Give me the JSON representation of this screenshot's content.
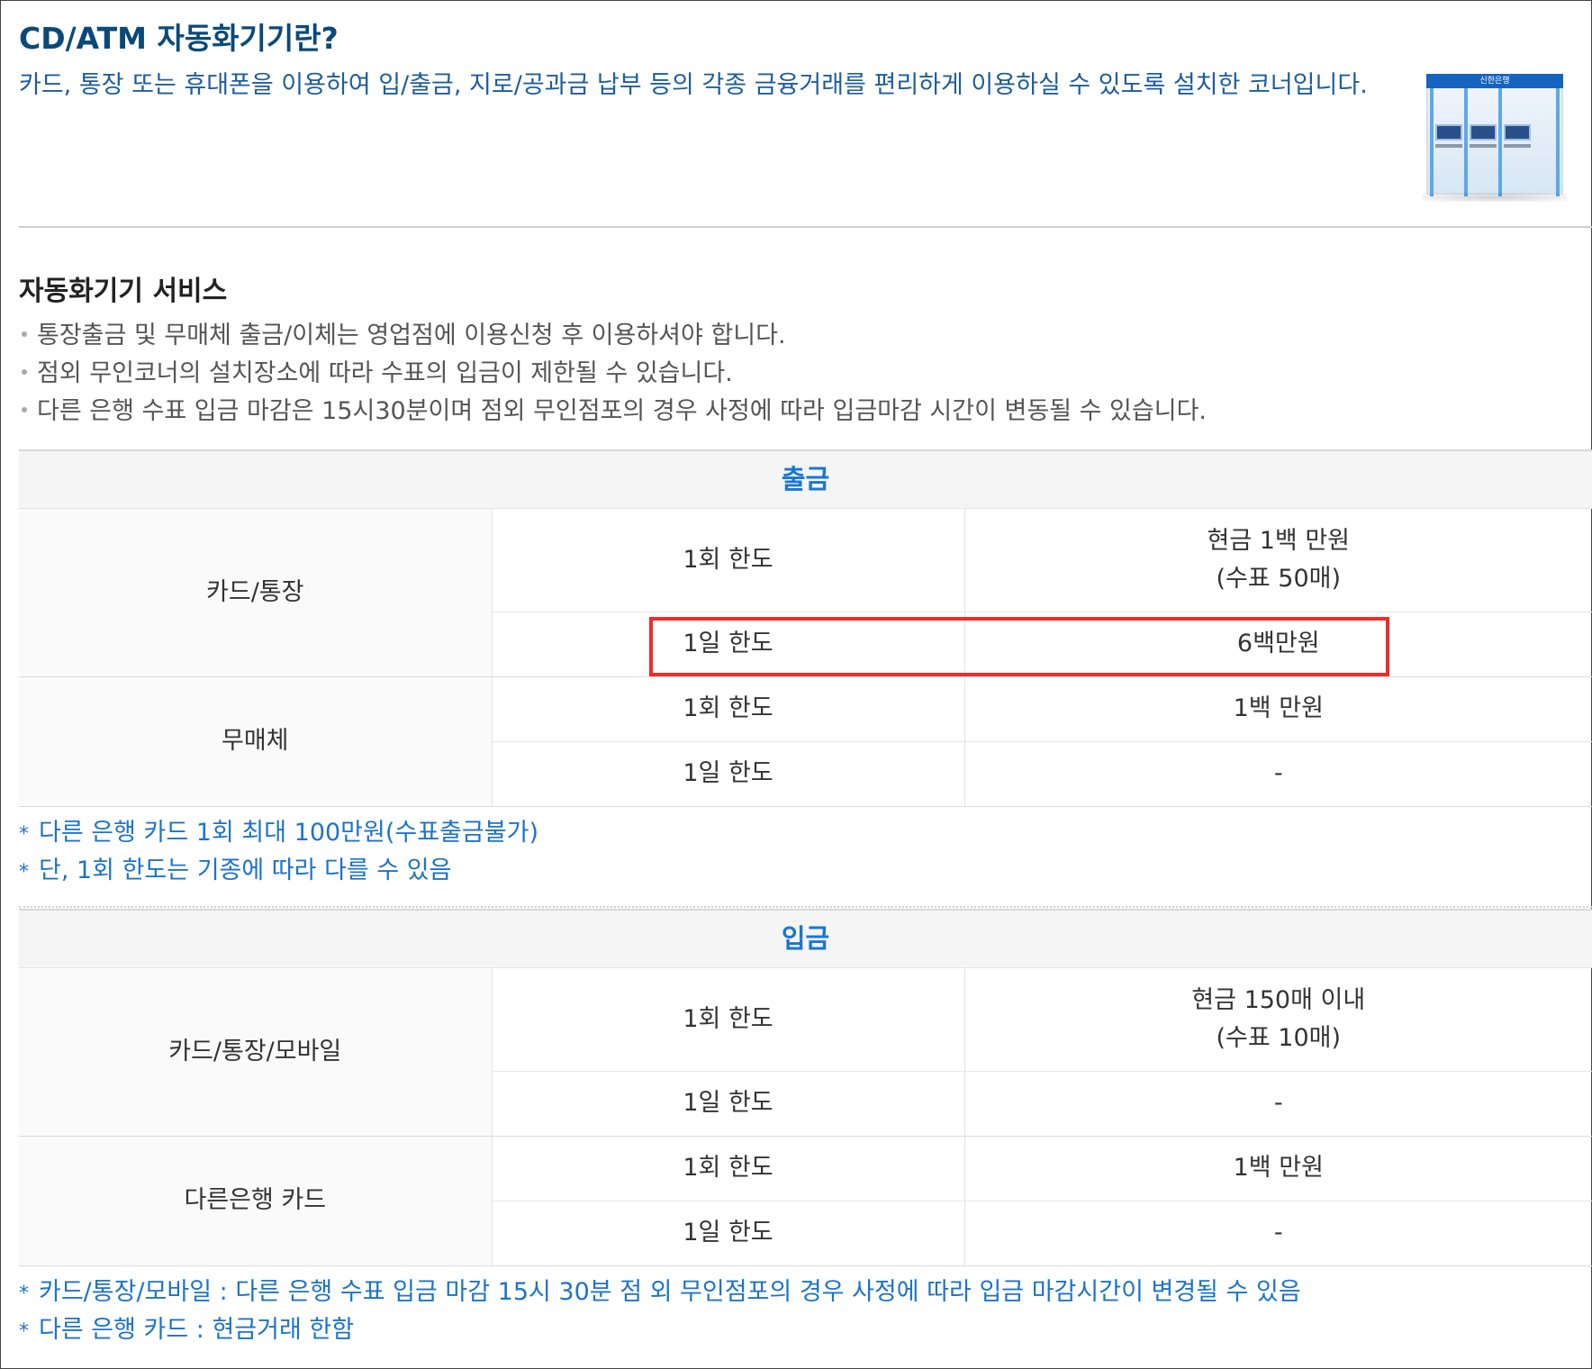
{
  "intro": {
    "title": "CD/ATM 자동화기기란?",
    "description": "카드, 통장 또는 휴대폰을 이용하여 입/출금, 지로/공과금 납부 등의 각종 금융거래를 편리하게 이용하실 수 있도록 설치한 코너입니다.",
    "atm_sign": "신한은행"
  },
  "service": {
    "title": "자동화기기 서비스",
    "bullets": [
      "통장출금 및 무매체 출금/이체는 영업점에 이용신청 후 이용하셔야 합니다.",
      "점외 무인코너의 설치장소에 따라 수표의 입금이 제한될 수 있습니다.",
      "다른 은행 수표 입금 마감은 15시30분이며 점외 무인점포의 경우 사정에 따라 입금마감 시간이 변동될 수 있습니다."
    ]
  },
  "withdraw": {
    "header": "출금",
    "groups": [
      {
        "label": "카드/통장",
        "rows": [
          {
            "limit": "1회 한도",
            "value_line1": "현금 1백 만원",
            "value_line2": "(수표 50매)"
          },
          {
            "limit": "1일 한도",
            "value_line1": "6백만원"
          }
        ]
      },
      {
        "label": "무매체",
        "rows": [
          {
            "limit": "1회 한도",
            "value_line1": "1백 만원"
          },
          {
            "limit": "1일 한도",
            "value_line1": "-"
          }
        ]
      }
    ],
    "notes": [
      "다른 은행 카드 1회 최대 100만원(수표출금불가)",
      "단, 1회 한도는 기종에 따라 다를 수 있음"
    ]
  },
  "deposit": {
    "header": "입금",
    "groups": [
      {
        "label": "카드/통장/모바일",
        "rows": [
          {
            "limit": "1회 한도",
            "value_line1": "현금 150매 이내",
            "value_line2": "(수표 10매)"
          },
          {
            "limit": "1일 한도",
            "value_line1": "-"
          }
        ]
      },
      {
        "label": "다른은행 카드",
        "rows": [
          {
            "limit": "1회 한도",
            "value_line1": "1백 만원"
          },
          {
            "limit": "1일 한도",
            "value_line1": "-"
          }
        ]
      }
    ],
    "notes": [
      "카드/통장/모바일 : 다른 은행 수표 입금 마감 15시 30분 점 외 무인점포의 경우 사정에 따라 입금 마감시간이 변경될 수 있음",
      "다른 은행 카드 : 현금거래 한함"
    ]
  },
  "colors": {
    "title": "#0a4a7a",
    "accent_blue": "#1976d2",
    "note_blue": "#1d73c8",
    "highlight_red": "#ef2b2b"
  },
  "icons": {
    "bullet": "dot",
    "note_marker": "asterisk"
  },
  "note_marker_glyph": "*"
}
